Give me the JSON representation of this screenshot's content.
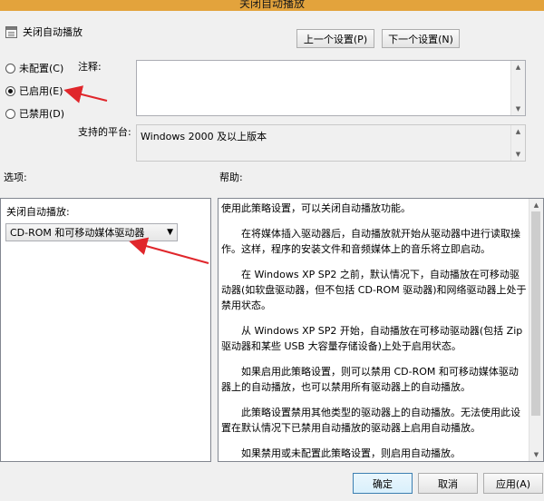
{
  "window": {
    "title": "关闭自动播放"
  },
  "header": {
    "policy_name": "关闭自动播放",
    "prev_label": "上一个设置(P)",
    "next_label": "下一个设置(N)"
  },
  "state": {
    "options": [
      {
        "label": "未配置(C)",
        "selected": false
      },
      {
        "label": "已启用(E)",
        "selected": true
      },
      {
        "label": "已禁用(D)",
        "selected": false
      }
    ]
  },
  "comment": {
    "label": "注释:",
    "value": ""
  },
  "platform": {
    "label": "支持的平台:",
    "value": "Windows 2000 及以上版本"
  },
  "sections": {
    "options_label": "选项:",
    "help_label": "帮助:"
  },
  "options_panel": {
    "field_label": "关闭自动播放:",
    "selected_value": "CD-ROM 和可移动媒体驱动器"
  },
  "help_text": [
    "使用此策略设置，可以关闭自动播放功能。",
    "在将媒体插入驱动器后，自动播放就开始从驱动器中进行读取操作。这样，程序的安装文件和音频媒体上的音乐将立即启动。",
    "在 Windows XP SP2 之前，默认情况下，自动播放在可移动驱动器(如软盘驱动器，但不包括 CD-ROM 驱动器)和网络驱动器上处于禁用状态。",
    "从 Windows XP SP2 开始，自动播放在可移动驱动器(包括 Zip 驱动器和某些 USB 大容量存储设备)上处于启用状态。",
    "如果启用此策略设置，则可以禁用 CD-ROM 和可移动媒体驱动器上的自动播放，也可以禁用所有驱动器上的自动播放。",
    "此策略设置禁用其他类型的驱动器上的自动播放。无法使用此设置在默认情况下已禁用自动播放的驱动器上启用自动播放。",
    "如果禁用或未配置此策略设置，则启用自动播放。"
  ],
  "footer": {
    "ok_label": "确定",
    "cancel_label": "取消",
    "apply_label": "应用(A)"
  },
  "colors": {
    "titlebar": "#e3a33c",
    "annotation_arrow": "#e0262b",
    "button_focus": "#3c7fb1"
  },
  "icons": {
    "policy": "policy-setting-icon",
    "scroll_up": "triangle-up-icon",
    "scroll_down": "triangle-down-icon",
    "dropdown": "chevron-down-icon"
  }
}
